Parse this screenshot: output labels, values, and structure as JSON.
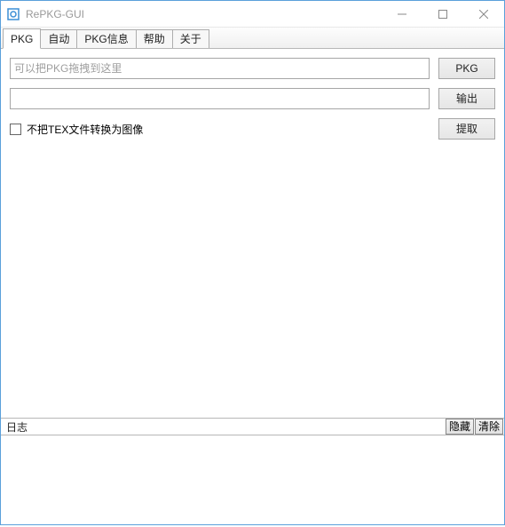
{
  "window": {
    "title": "RePKG-GUI"
  },
  "tabs": [
    {
      "label": "PKG"
    },
    {
      "label": "自动"
    },
    {
      "label": "PKG信息"
    },
    {
      "label": "帮助"
    },
    {
      "label": "关于"
    }
  ],
  "pkg_row": {
    "placeholder": "可以把PKG拖拽到这里",
    "value": "",
    "button": "PKG"
  },
  "output_row": {
    "value": "",
    "button": "输出"
  },
  "checkbox": {
    "label": "不把TEX文件转换为图像"
  },
  "extract_button": "提取",
  "log": {
    "label": "日志",
    "hide": "隐藏",
    "clear": "清除",
    "content": ""
  }
}
